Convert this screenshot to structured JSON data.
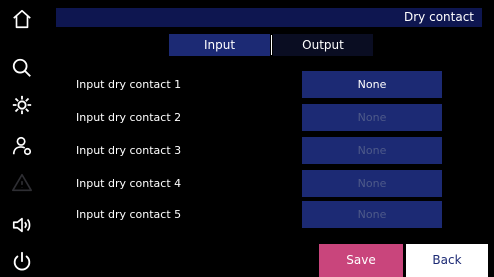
{
  "header": {
    "title": "Dry contact"
  },
  "sidebar": {
    "items": [
      {
        "icon": "home-icon"
      },
      {
        "icon": "search-icon"
      },
      {
        "icon": "gear-icon"
      },
      {
        "icon": "user-settings-icon"
      },
      {
        "icon": "warning-icon",
        "state": "disabled"
      },
      {
        "icon": "speaker-icon"
      },
      {
        "icon": "power-icon"
      }
    ]
  },
  "tabs": [
    {
      "label": "Input",
      "selected": true
    },
    {
      "label": "Output",
      "selected": false
    }
  ],
  "rows": [
    {
      "label": "Input dry contact 1",
      "value": "None",
      "enabled": true
    },
    {
      "label": "Input dry contact 2",
      "value": "None",
      "enabled": false
    },
    {
      "label": "Input dry contact 3",
      "value": "None",
      "enabled": false
    },
    {
      "label": "Input dry contact 4",
      "value": "None",
      "enabled": false
    },
    {
      "label": "Input dry contact 5",
      "value": "None",
      "enabled": false
    }
  ],
  "actions": {
    "save_label": "Save",
    "back_label": "Back"
  },
  "colors": {
    "background": "#000000",
    "panel": "#1c2a74",
    "title_bar": "#0e1650",
    "save": "#c9457c",
    "back": "#ffffff",
    "disabled_text": "#4e5a8a"
  }
}
